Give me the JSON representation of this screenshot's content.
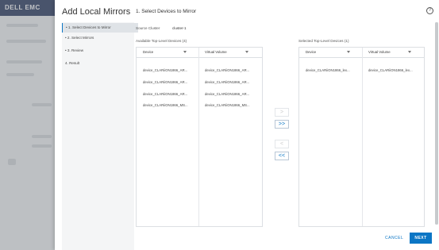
{
  "background": {
    "logo": "DELL EMC"
  },
  "dialog": {
    "title": "Add Local Mirrors",
    "help_icon": "?",
    "steps": [
      {
        "label": "• 1. Select Devices to Mirror",
        "active": true
      },
      {
        "label": "• 2. Select Mirrors",
        "active": false
      },
      {
        "label": "• 3. Review",
        "active": false
      },
      {
        "label": "4. Result",
        "active": false
      }
    ],
    "step_title": "1. Select Devices to Mirror",
    "source_cluster": {
      "label": "Source Cluster",
      "value": "cluster-1"
    },
    "available": {
      "label": "Available Top-Level Devices (4)",
      "columns": [
        "Device",
        "Virtual Volume"
      ],
      "rows": [
        [
          "device_CLARiiON1866_AR...",
          "device_CLARiiON1866_AR..."
        ],
        [
          "device_CLARiiON1866_AR...",
          "device_CLARiiON1866_AR..."
        ],
        [
          "device_CLARiiON1866_AR...",
          "device_CLARiiON1866_AR..."
        ],
        [
          "device_CLARiiON1866_MS...",
          "device_CLARiiON1866_MS..."
        ]
      ]
    },
    "selected": {
      "label": "Selected Top-Level Devices (1)",
      "columns": [
        "Device",
        "Virtual Volume"
      ],
      "rows": [
        [
          "device_CLARiiON1866_lex...",
          "device_CLARiiON1866_lex..."
        ]
      ]
    },
    "transfer_buttons": [
      ">",
      ">>",
      "<",
      "<<"
    ],
    "cancel_label": "CANCEL",
    "next_label": "NEXT",
    "accent_color": "#0b76c5"
  }
}
